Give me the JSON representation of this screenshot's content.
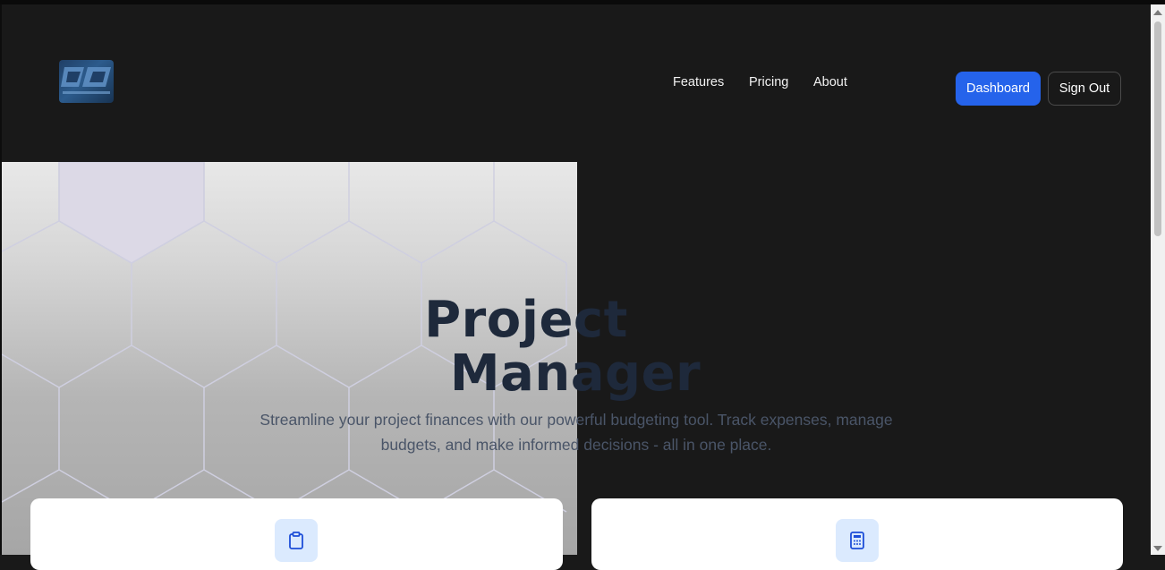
{
  "nav": {
    "logo_icon": "company-logo",
    "links": [
      "Features",
      "Pricing",
      "About"
    ],
    "dashboard_label": "Dashboard",
    "signout_label": "Sign Out"
  },
  "hero": {
    "title_line1": "Project",
    "title_line2": "Manager",
    "subtitle": "Streamline your project finances with our powerful budgeting tool. Track expenses, manage budgets, and make informed decisions - all in one place."
  },
  "cards": [
    {
      "icon": "clipboard-icon"
    },
    {
      "icon": "calculator-icon"
    }
  ],
  "colors": {
    "background": "#191919",
    "accent": "#2563eb",
    "title": "#1e293b",
    "icon_bg": "#dbeafe"
  }
}
